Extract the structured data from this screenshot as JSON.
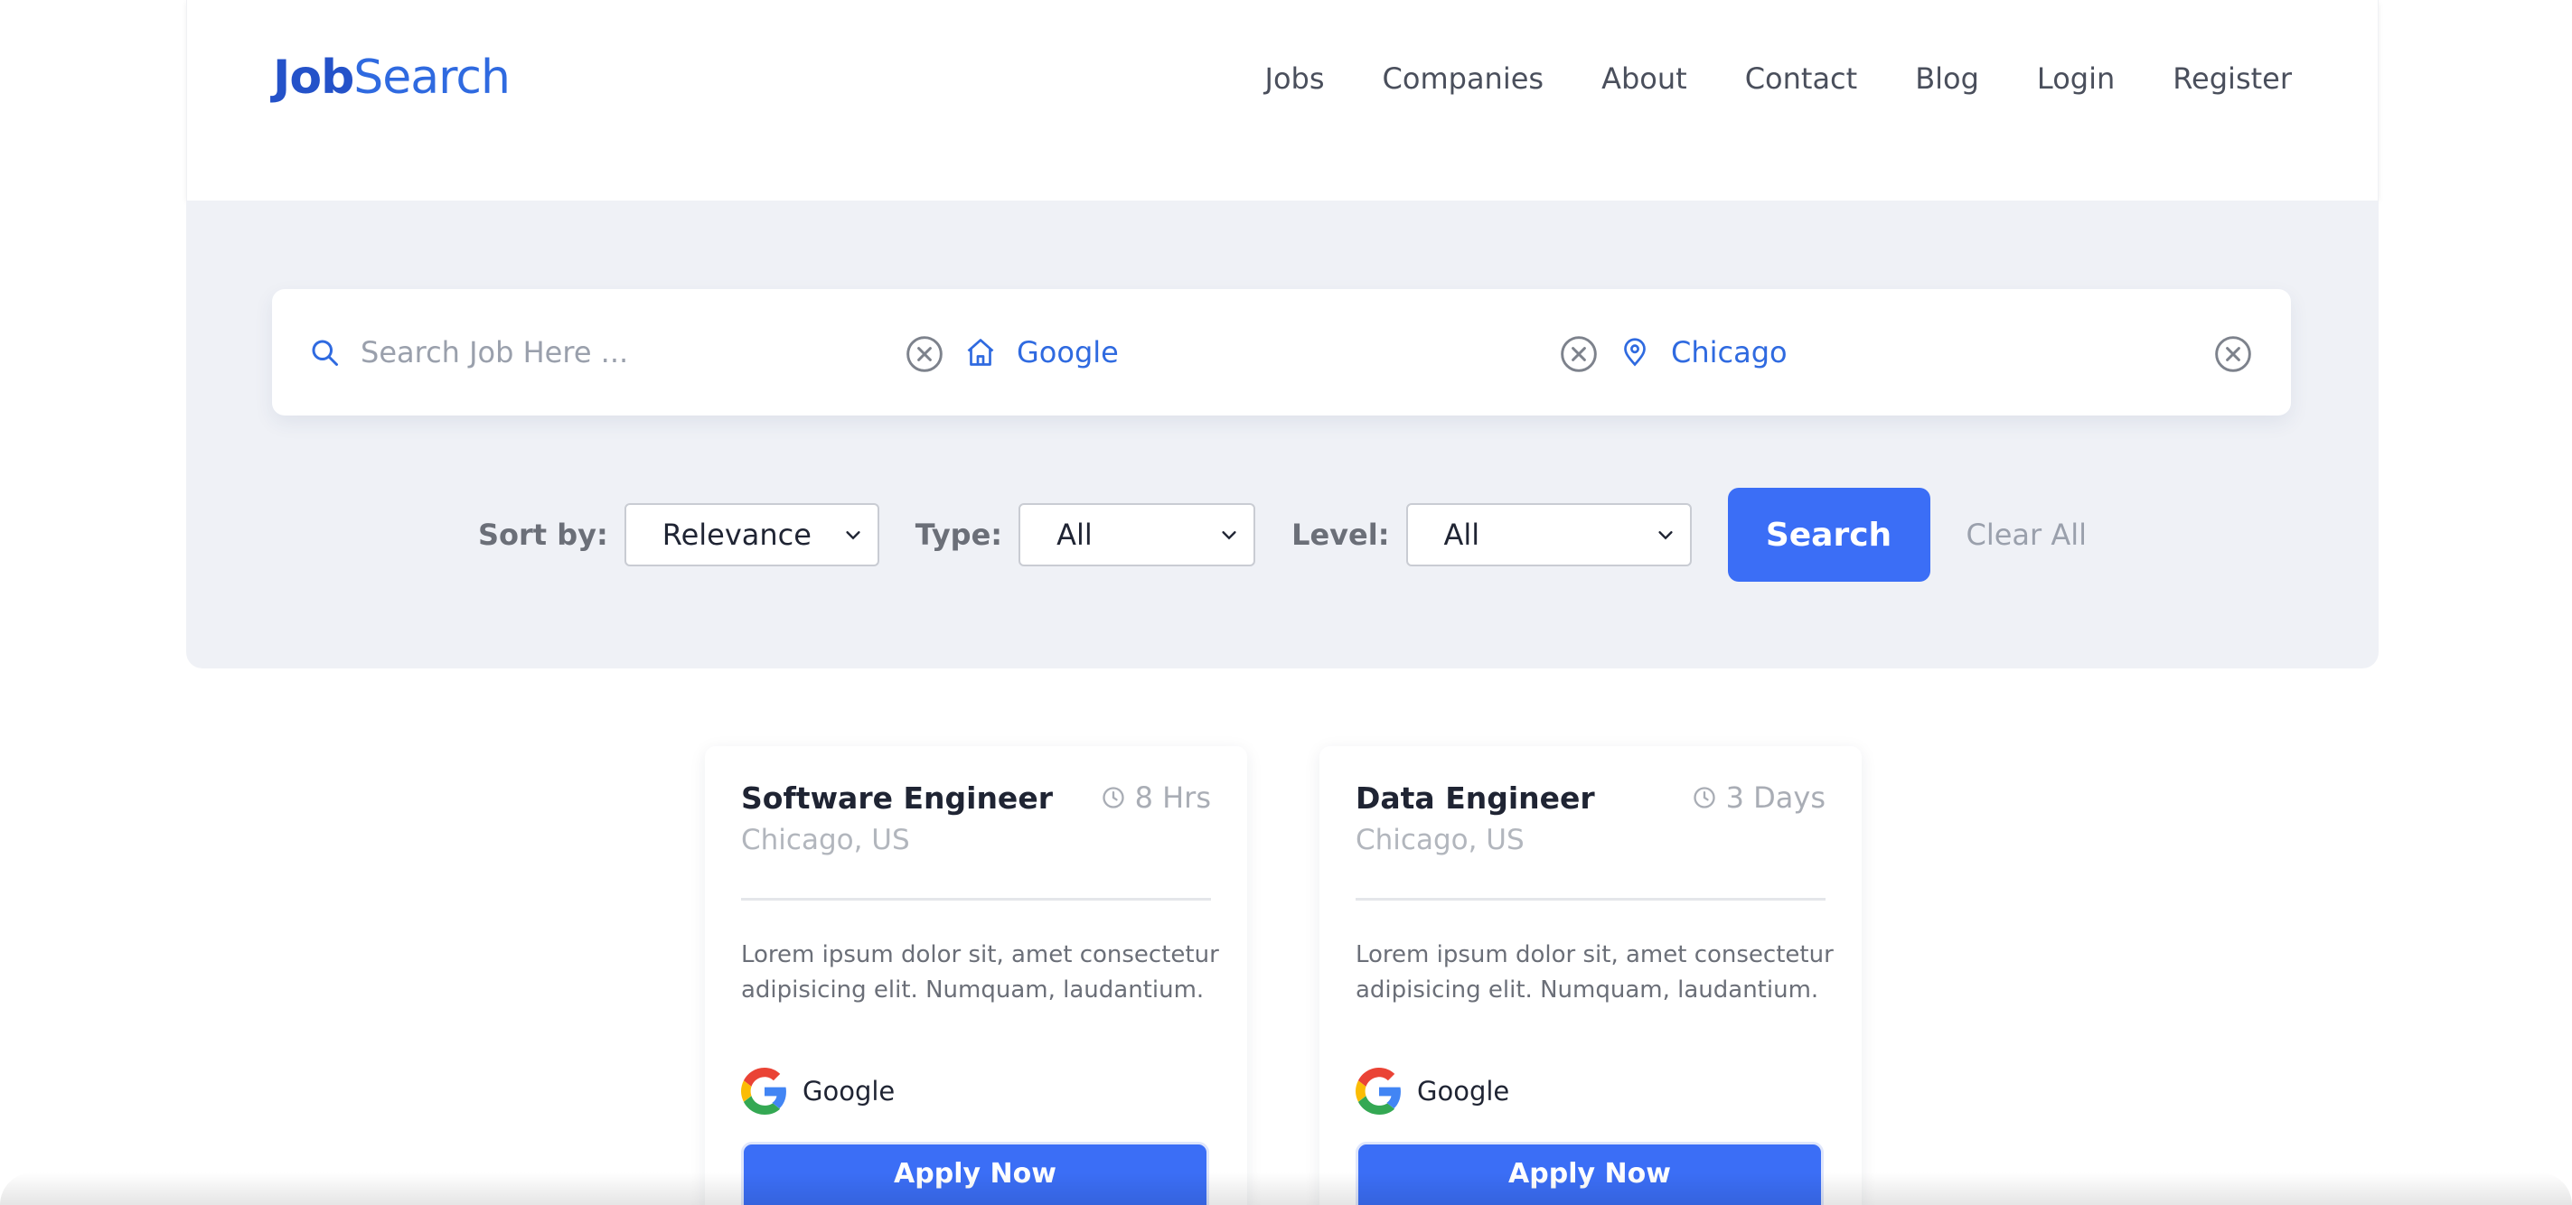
{
  "brand": {
    "part1": "Job",
    "part2": "Search"
  },
  "nav": [
    "Jobs",
    "Companies",
    "About",
    "Contact",
    "Blog",
    "Login",
    "Register"
  ],
  "search": {
    "keyword": {
      "placeholder": "Search Job Here ...",
      "value": ""
    },
    "company": {
      "value": "Google"
    },
    "location": {
      "value": "Chicago"
    }
  },
  "filters": {
    "sort_label": "Sort by:",
    "sort_value": "Relevance",
    "type_label": "Type:",
    "type_value": "All",
    "level_label": "Level:",
    "level_value": "All",
    "search_button": "Search",
    "clear_all": "Clear All"
  },
  "jobs": [
    {
      "title": "Software Engineer",
      "posted": "8 Hrs",
      "location": "Chicago, US",
      "description": "Lorem ipsum dolor sit, amet consectetur adipisicing elit. Numquam, laudantium.",
      "company": "Google",
      "apply_label": "Apply Now"
    },
    {
      "title": "Data Engineer",
      "posted": "3 Days",
      "location": "Chicago, US",
      "description": "Lorem ipsum dolor sit, amet consectetur adipisicing elit. Numquam, laudantium.",
      "company": "Google",
      "apply_label": "Apply Now"
    }
  ],
  "colors": {
    "accent": "#3b6ef6",
    "logo": "#2452c9",
    "panel_bg": "#eff1f6"
  }
}
